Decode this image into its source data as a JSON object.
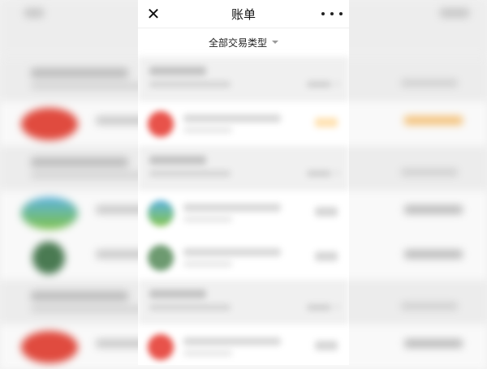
{
  "nav": {
    "title": "账单",
    "close_icon": "close-icon",
    "more_icon": "more-icon"
  },
  "filter": {
    "label": "全部交易类型",
    "caret_icon": "caret-down-icon"
  },
  "colors": {
    "sheet_background": "#ffffff",
    "page_background": "#f2f2f2",
    "accent_orange": "#f5a623"
  }
}
